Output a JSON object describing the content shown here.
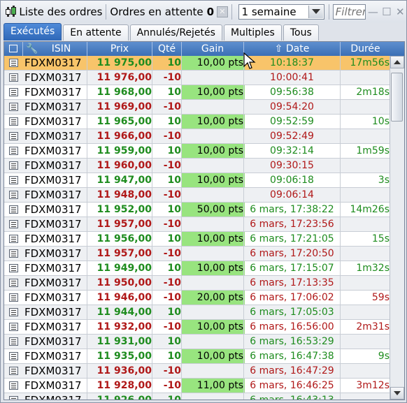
{
  "window": {
    "title": "Liste des ordres",
    "pending_label": "Ordres en attente",
    "pending_count": "0",
    "period": "1 semaine",
    "filter_placeholder": "Filtrer"
  },
  "tabs": [
    "Exécutés",
    "En attente",
    "Annulés/Rejetés",
    "Multiples",
    "Tous"
  ],
  "columns": {
    "isin": "ISIN",
    "prix": "Prix",
    "qte": "Qté",
    "gain": "Gain",
    "date": "Date",
    "duree": "Durée"
  },
  "rows": [
    {
      "isin": "FDXM0317",
      "prix": "11 975,00",
      "qte": "10",
      "gain": "10,00 pts",
      "date": "10:18:37",
      "duree": "17m56s",
      "side": "pos",
      "selected": true
    },
    {
      "isin": "FDXM0317",
      "prix": "11 976,00",
      "qte": "-10",
      "gain": "",
      "date": "10:00:41",
      "duree": "",
      "side": "neg"
    },
    {
      "isin": "FDXM0317",
      "prix": "11 968,00",
      "qte": "10",
      "gain": "10,00 pts",
      "date": "09:56:38",
      "duree": "2m18s",
      "side": "pos"
    },
    {
      "isin": "FDXM0317",
      "prix": "11 969,00",
      "qte": "-10",
      "gain": "",
      "date": "09:54:20",
      "duree": "",
      "side": "neg"
    },
    {
      "isin": "FDXM0317",
      "prix": "11 965,00",
      "qte": "10",
      "gain": "10,00 pts",
      "date": "09:52:59",
      "duree": "10s",
      "side": "pos"
    },
    {
      "isin": "FDXM0317",
      "prix": "11 966,00",
      "qte": "-10",
      "gain": "",
      "date": "09:52:49",
      "duree": "",
      "side": "neg"
    },
    {
      "isin": "FDXM0317",
      "prix": "11 959,00",
      "qte": "10",
      "gain": "10,00 pts",
      "date": "09:32:14",
      "duree": "1m59s",
      "side": "pos"
    },
    {
      "isin": "FDXM0317",
      "prix": "11 960,00",
      "qte": "-10",
      "gain": "",
      "date": "09:30:15",
      "duree": "",
      "side": "neg"
    },
    {
      "isin": "FDXM0317",
      "prix": "11 947,00",
      "qte": "10",
      "gain": "10,00 pts",
      "date": "09:06:18",
      "duree": "3s",
      "side": "pos"
    },
    {
      "isin": "FDXM0317",
      "prix": "11 948,00",
      "qte": "-10",
      "gain": "",
      "date": "09:06:14",
      "duree": "",
      "side": "neg"
    },
    {
      "isin": "FDXM0317",
      "prix": "11 952,00",
      "qte": "10",
      "gain": "50,00 pts",
      "date": "6 mars, 17:38:22",
      "duree": "14m26s",
      "side": "pos"
    },
    {
      "isin": "FDXM0317",
      "prix": "11 957,00",
      "qte": "-10",
      "gain": "",
      "date": "6 mars, 17:23:56",
      "duree": "",
      "side": "neg"
    },
    {
      "isin": "FDXM0317",
      "prix": "11 956,00",
      "qte": "10",
      "gain": "10,00 pts",
      "date": "6 mars, 17:21:05",
      "duree": "15s",
      "side": "pos"
    },
    {
      "isin": "FDXM0317",
      "prix": "11 957,00",
      "qte": "-10",
      "gain": "",
      "date": "6 mars, 17:20:50",
      "duree": "",
      "side": "neg"
    },
    {
      "isin": "FDXM0317",
      "prix": "11 949,00",
      "qte": "10",
      "gain": "10,00 pts",
      "date": "6 mars, 17:15:07",
      "duree": "1m32s",
      "side": "pos"
    },
    {
      "isin": "FDXM0317",
      "prix": "11 950,00",
      "qte": "-10",
      "gain": "",
      "date": "6 mars, 17:13:35",
      "duree": "",
      "side": "neg"
    },
    {
      "isin": "FDXM0317",
      "prix": "11 946,00",
      "qte": "-10",
      "gain": "20,00 pts",
      "date": "6 mars, 17:06:02",
      "duree": "59s",
      "side": "neg"
    },
    {
      "isin": "FDXM0317",
      "prix": "11 944,00",
      "qte": "10",
      "gain": "",
      "date": "6 mars, 17:05:03",
      "duree": "",
      "side": "pos"
    },
    {
      "isin": "FDXM0317",
      "prix": "11 932,00",
      "qte": "-10",
      "gain": "10,00 pts",
      "date": "6 mars, 16:56:00",
      "duree": "2m31s",
      "side": "neg"
    },
    {
      "isin": "FDXM0317",
      "prix": "11 931,00",
      "qte": "10",
      "gain": "",
      "date": "6 mars, 16:53:29",
      "duree": "",
      "side": "pos"
    },
    {
      "isin": "FDXM0317",
      "prix": "11 935,00",
      "qte": "10",
      "gain": "10,00 pts",
      "date": "6 mars, 16:47:38",
      "duree": "9s",
      "side": "pos"
    },
    {
      "isin": "FDXM0317",
      "prix": "11 936,00",
      "qte": "-10",
      "gain": "",
      "date": "6 mars, 16:47:29",
      "duree": "",
      "side": "neg"
    },
    {
      "isin": "FDXM0317",
      "prix": "11 928,00",
      "qte": "-10",
      "gain": "11,00 pts",
      "date": "6 mars, 16:46:25",
      "duree": "3m12s",
      "side": "neg"
    },
    {
      "isin": "FDXM0317",
      "prix": "11 926,00",
      "qte": "10",
      "gain": "",
      "date": "6 mars, 16:43:13",
      "duree": "",
      "side": "pos"
    }
  ],
  "colors": {
    "positive": "#1e8c1e",
    "negative": "#b01818",
    "gain_bg": "#98e47f",
    "selected": "#f8c46a",
    "accent": "#3b6fb5"
  }
}
